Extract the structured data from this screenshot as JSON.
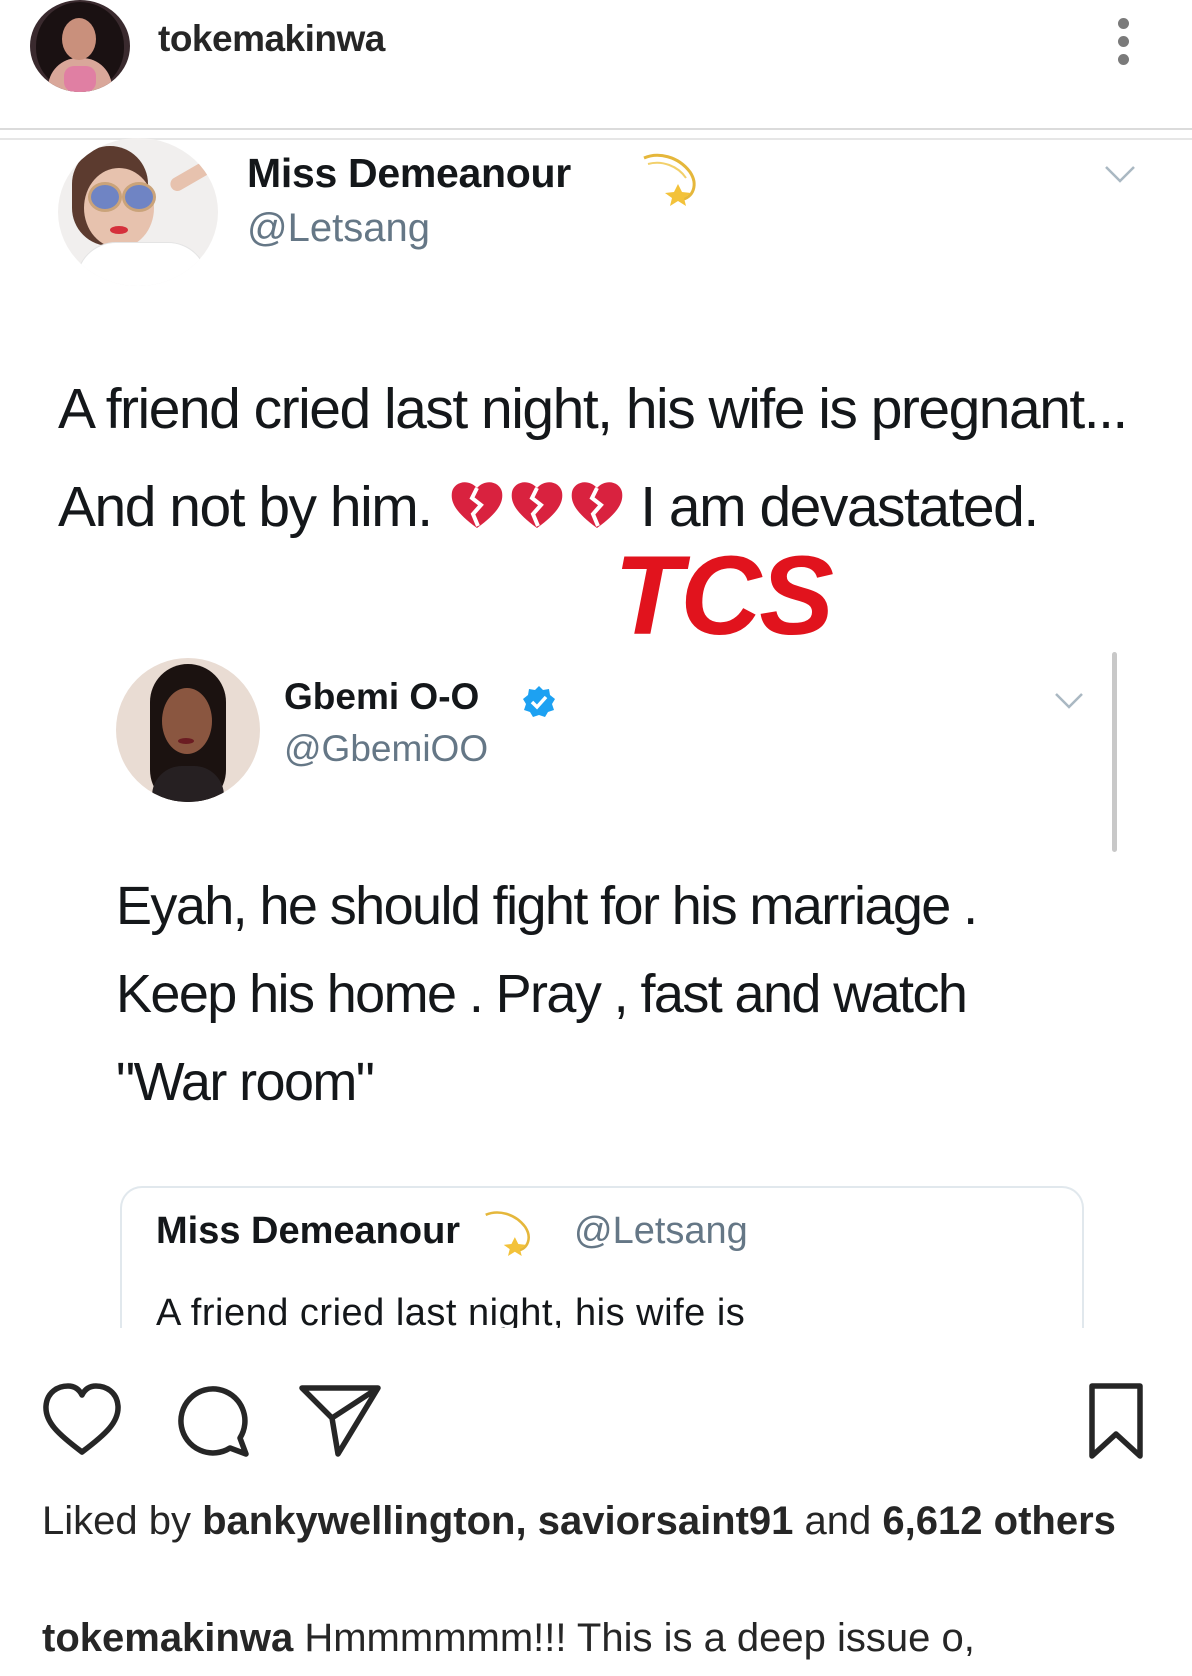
{
  "post": {
    "username": "tokemakinwa"
  },
  "tweet": {
    "name": "Miss Demeanour",
    "handle": "@Letsang",
    "text_part1": "A friend cried last night, his wife is pregnant... And not by him.",
    "text_part2": "I am devastated.",
    "emoji": "broken-heart-icon",
    "emoji_count": 3
  },
  "watermark": "TCS",
  "reply": {
    "name": "Gbemi O-O",
    "handle": "@GbemiOO",
    "verified": true,
    "line1": "Eyah, he should fight for his marriage .",
    "line2": "Keep his home . Pray , fast and watch",
    "line3": "\"War room\""
  },
  "quoted": {
    "name": "Miss Demeanour",
    "handle": "@Letsang",
    "text": "A friend cried last night, his wife is"
  },
  "likes": {
    "prefix": "Liked by",
    "user1": "bankywellington,",
    "user2": "saviorsaint91",
    "middle": "and",
    "count": "6,612 others"
  },
  "caption": {
    "username": "tokemakinwa",
    "text": "Hmmmmmm!!! This is a deep issue o,"
  },
  "colors": {
    "watermark": "#e1131d",
    "handle": "#657786",
    "verified": "#1da1f2",
    "broken_heart": "#d9223f"
  }
}
